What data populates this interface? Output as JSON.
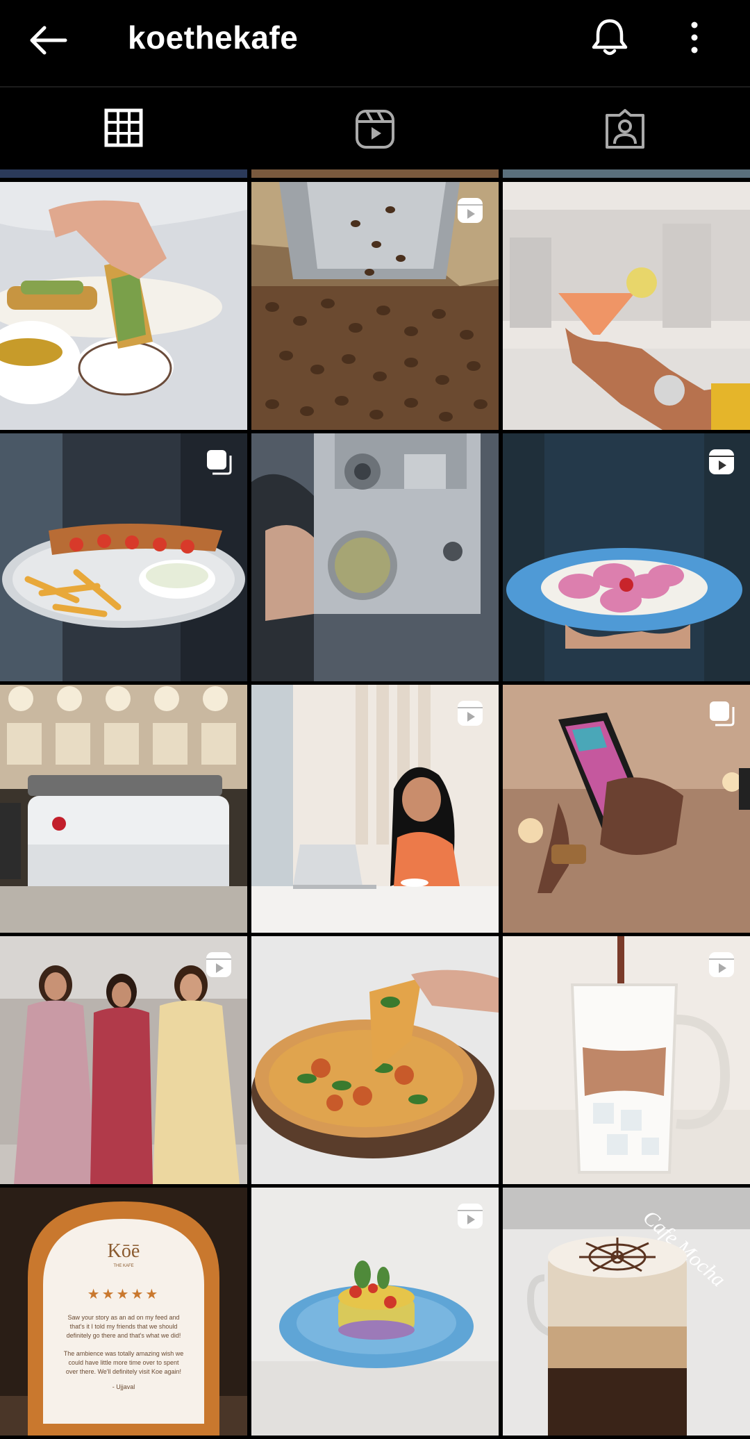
{
  "header": {
    "title": "koethekafe",
    "back_icon": "arrow-left-icon",
    "notification_icon": "bell-icon",
    "more_icon": "more-vertical-icon"
  },
  "tabs": [
    {
      "name": "posts",
      "icon": "grid-icon",
      "selected": true
    },
    {
      "name": "reels",
      "icon": "reels-icon",
      "selected": false
    },
    {
      "name": "tagged",
      "icon": "tagged-person-icon",
      "selected": false
    }
  ],
  "posts": [
    {
      "subject": "tacos with sauce",
      "badge": null
    },
    {
      "subject": "coffee beans falling",
      "badge": "reel-icon"
    },
    {
      "subject": "orange cocktail",
      "badge": null
    },
    {
      "subject": "sandwich and fries",
      "badge": "carousel-icon"
    },
    {
      "subject": "coffee roaster machine",
      "badge": null
    },
    {
      "subject": "pink ravioli plate",
      "badge": "reel-icon"
    },
    {
      "subject": "espresso machine",
      "badge": null
    },
    {
      "subject": "woman with laptop",
      "badge": "reel-icon"
    },
    {
      "subject": "phone with menu",
      "badge": "carousel-icon"
    },
    {
      "subject": "three women in ethnic wear",
      "badge": "reel-icon"
    },
    {
      "subject": "pizza slice",
      "badge": null
    },
    {
      "subject": "pouring iced drink",
      "badge": "reel-icon"
    },
    {
      "subject": "customer review card",
      "badge": null,
      "card": {
        "logo": "Kōē",
        "logo_sub": "THE KAFE",
        "stars": "★★★★★",
        "review": [
          "Saw your story as an ad on my feed and",
          "that's it I told my friends that we should",
          "definitely go there and that's what we did!",
          "",
          "The ambience was totally amazing wish we",
          "could have little more time over to spent",
          "over there. We'll definitely visit Koe again!"
        ],
        "author": "- Ujjaval"
      }
    },
    {
      "subject": "salad tower on blue plate",
      "badge": "reel-icon"
    },
    {
      "subject": "cafe mocha",
      "badge": null,
      "overlay_text": "Cafe Mocha"
    }
  ],
  "colors": {
    "background": "#000000",
    "icon": "#ffffff",
    "divider": "#1c1c1c"
  }
}
